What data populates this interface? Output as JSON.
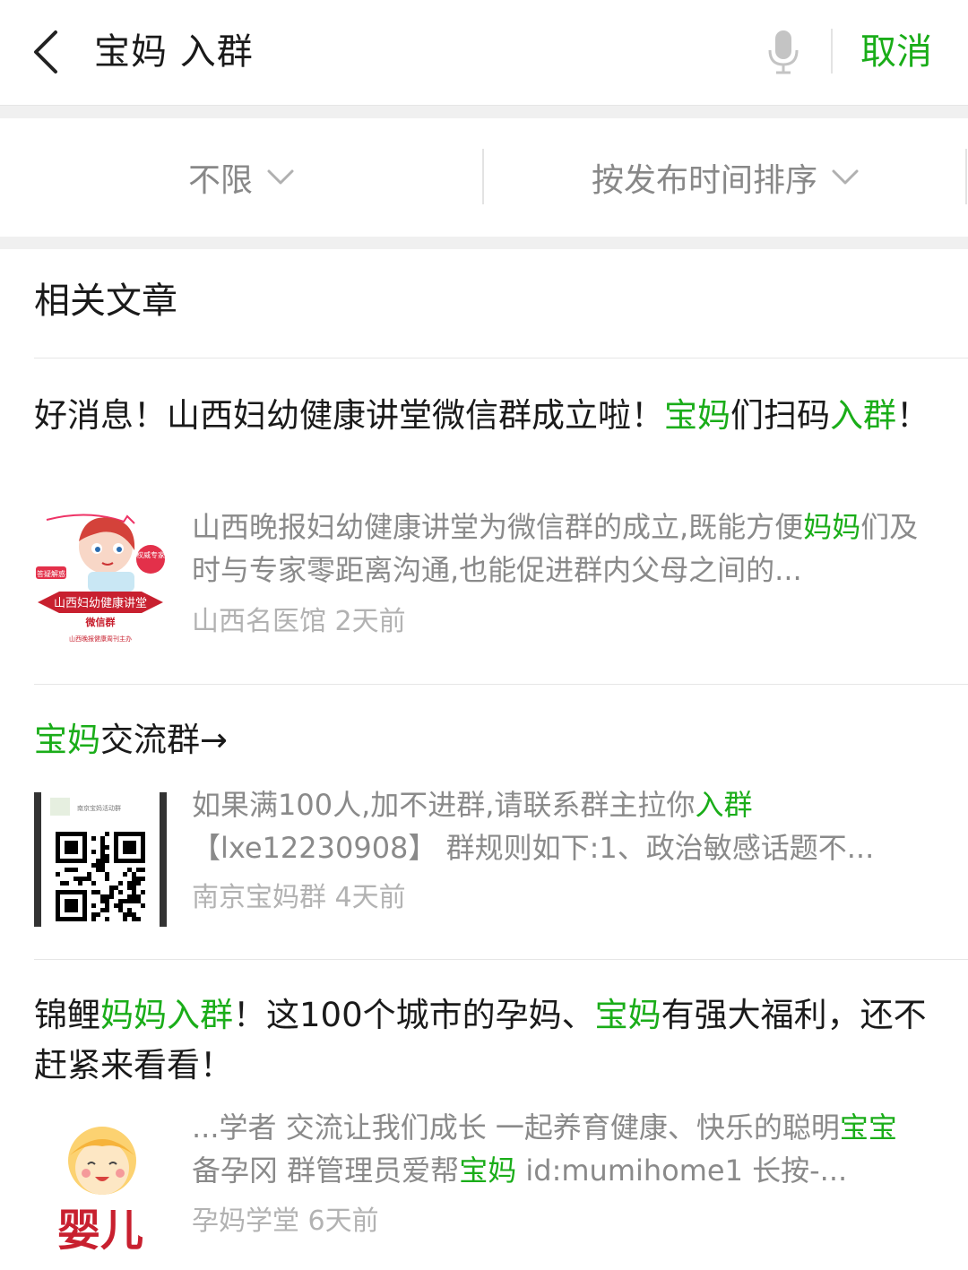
{
  "search": {
    "query": "宝妈 入群",
    "cancel_label": "取消"
  },
  "filters": {
    "scope": "不限",
    "sort": "按发布时间排序"
  },
  "section": {
    "title": "相关文章"
  },
  "articles": [
    {
      "title_parts": [
        {
          "t": "好消息！山西妇幼健康讲堂微信群成立啦！",
          "hl": false
        },
        {
          "t": "宝妈",
          "hl": true
        },
        {
          "t": "们扫码",
          "hl": false
        },
        {
          "t": "入群",
          "hl": true
        },
        {
          "t": "！",
          "hl": false
        }
      ],
      "desc_parts": [
        {
          "t": "山西晚报妇幼健康讲堂为微信群的成立,既能方便",
          "hl": false
        },
        {
          "t": "妈妈",
          "hl": true
        },
        {
          "t": "们及时与专家零距离沟通,也能促进群内父母之间的...",
          "hl": false
        }
      ],
      "source": "山西名医馆",
      "time": "2天前",
      "thumb": {
        "banner_text": "山西妇幼健康讲堂",
        "sub_text": "微信群",
        "badge": "权威专家",
        "tag": "答疑解惑",
        "footer": "山西晚报健康周刊主办"
      }
    },
    {
      "title_parts": [
        {
          "t": "宝妈",
          "hl": true
        },
        {
          "t": "交流群→",
          "hl": false
        }
      ],
      "desc_parts": [
        {
          "t": "如果满100人,加不进群,请联系群主拉你",
          "hl": false
        },
        {
          "t": "入群",
          "hl": true
        },
        {
          "t": "【lxe12230908】 群规则如下:1、政治敏感话题不...",
          "hl": false
        }
      ],
      "source": "南京宝妈群",
      "time": "4天前",
      "thumb": {
        "caption": "南京宝妈活动群"
      }
    },
    {
      "title_parts": [
        {
          "t": "锦鲤",
          "hl": false
        },
        {
          "t": "妈妈入群",
          "hl": true
        },
        {
          "t": "！这100个城市的孕妈、",
          "hl": false
        },
        {
          "t": "宝妈",
          "hl": true
        },
        {
          "t": "有强大福利，还不赶紧来看看！",
          "hl": false
        }
      ],
      "desc_parts": [
        {
          "t": "...学者 交流让我们成长 一起养育健康、快乐的聪明",
          "hl": false
        },
        {
          "t": "宝宝",
          "hl": true
        },
        {
          "t": " 备孕冈 群管理员爱帮",
          "hl": false
        },
        {
          "t": "宝妈",
          "hl": true
        },
        {
          "t": " id:mumihome1 长按-...",
          "hl": false
        }
      ],
      "source": "孕妈学堂",
      "time": "6天前",
      "thumb": {
        "text": "婴儿"
      }
    }
  ],
  "colors": {
    "accent": "#1aad19",
    "meta": "#b2b2b2",
    "desc": "#8a8a8a",
    "divider": "#e6e6e6"
  }
}
